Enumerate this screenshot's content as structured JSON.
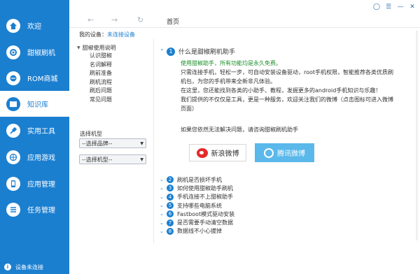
{
  "sidebar": {
    "items": [
      {
        "label": "欢迎",
        "icon": "home-icon",
        "active": false
      },
      {
        "label": "甜椒刷机",
        "icon": "flash-icon",
        "active": false
      },
      {
        "label": "ROM商城",
        "icon": "store-icon",
        "active": false
      },
      {
        "label": "知识库",
        "icon": "book-icon",
        "active": true
      },
      {
        "label": "实用工具",
        "icon": "tools-icon",
        "active": false
      },
      {
        "label": "应用游戏",
        "icon": "games-icon",
        "active": false
      },
      {
        "label": "应用管理",
        "icon": "phone-icon",
        "active": false
      },
      {
        "label": "任务管理",
        "icon": "tasks-icon",
        "active": false
      }
    ],
    "status_text": "设备未连接"
  },
  "topbar": {
    "back_icon": "back-arrow-icon",
    "forward_icon": "forward-arrow-icon",
    "refresh_icon": "refresh-icon",
    "page_tab": "首页"
  },
  "breadcrumb": {
    "label": "我的设备：",
    "link": "未连接设备"
  },
  "tree": {
    "root": "甜椒使用说明",
    "children": [
      "认识甜椒",
      "名词解释",
      "刷前准备",
      "刷机流程",
      "刷后问题",
      "常见问题"
    ]
  },
  "model": {
    "label": "选择机型",
    "brand_select": "--选择品牌--",
    "model_select": "--选择机型--"
  },
  "main": {
    "question": {
      "num": "1",
      "title": "什么是甜椒刷机助手"
    },
    "answer_lines": [
      "使用甜椒助手，所有功能均是永久免费。",
      "只需连接手机，轻松一步，可自动安装设备驱动，root手机权限，智能推荐各类优质刷",
      "机包，为您的手机带来全新非凡体验。",
      "在这里，您还能找到各类的小助手、教程，发掘更多的android手机知识与乐趣！",
      "我们提供的不仅仅是工具，更是一种服务，欢迎关注我们的微博（点击图标可进入微博",
      "页面）"
    ],
    "contact": "如果您依然无法解决问题，请咨询甜椒刷机助手",
    "weibo_button": "新浪微博",
    "tencent_button": "腾讯微博",
    "questions": [
      {
        "num": "2",
        "title": "刷机是否损坏手机"
      },
      {
        "num": "3",
        "title": "如何使用甜椒助手刷机"
      },
      {
        "num": "4",
        "title": "手机连接不上甜椒助手"
      },
      {
        "num": "5",
        "title": "支持哪些电脑系统"
      },
      {
        "num": "6",
        "title": "Fastboot模式驱动安装"
      },
      {
        "num": "7",
        "title": "是否需要手动清空数据"
      },
      {
        "num": "8",
        "title": "数据线不小心拔掉"
      }
    ]
  },
  "colors": {
    "sidebar_bg": "#1b7fd0",
    "accent": "#1b7fd0",
    "highlight_text": "#1b8f2a",
    "tencent_btn": "#5bb8ea"
  }
}
